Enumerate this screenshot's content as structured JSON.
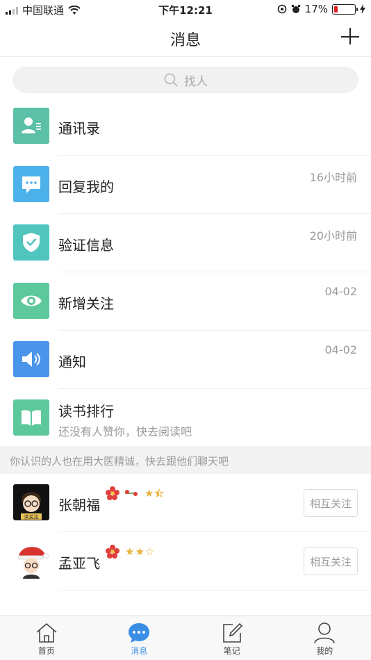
{
  "status_bar": {
    "carrier": "中国联通",
    "time": "下午12:21",
    "battery": "17%",
    "battery_level": 0.17
  },
  "header": {
    "title": "消息"
  },
  "search": {
    "placeholder": "找人"
  },
  "items": [
    {
      "label": "通讯录",
      "time": "",
      "color": "#5bc0a5",
      "icon": "contacts-icon"
    },
    {
      "label": "回复我的",
      "time": "16小时前",
      "color": "#4db1ea",
      "icon": "chat-bubble-icon"
    },
    {
      "label": "验证信息",
      "time": "20小时前",
      "color": "#4fc5bd",
      "icon": "shield-check-icon"
    },
    {
      "label": "新增关注",
      "time": "04-02",
      "color": "#5cc89c",
      "icon": "eye-icon"
    },
    {
      "label": "通知",
      "time": "04-02",
      "color": "#4a94ec",
      "icon": "speaker-icon"
    },
    {
      "label": "读书排行",
      "subtitle": "还没有人赞你，快去阅读吧",
      "color": "#5cc89c",
      "icon": "book-icon"
    }
  ],
  "section_hint": "你认识的人也在用大医精诚，快去跟他们聊天吧",
  "suggestions": [
    {
      "name": "张朝福",
      "follow_label": "相互关注",
      "rating": 2.5,
      "avatar_text": "求关注"
    },
    {
      "name": "孟亚飞",
      "follow_label": "相互关注",
      "rating": 2
    }
  ],
  "tabs": [
    {
      "label": "首页",
      "icon": "home-icon",
      "active": false
    },
    {
      "label": "消息",
      "icon": "message-icon",
      "active": true
    },
    {
      "label": "笔记",
      "icon": "note-icon",
      "active": false
    },
    {
      "label": "我的",
      "icon": "user-icon",
      "active": false
    }
  ]
}
